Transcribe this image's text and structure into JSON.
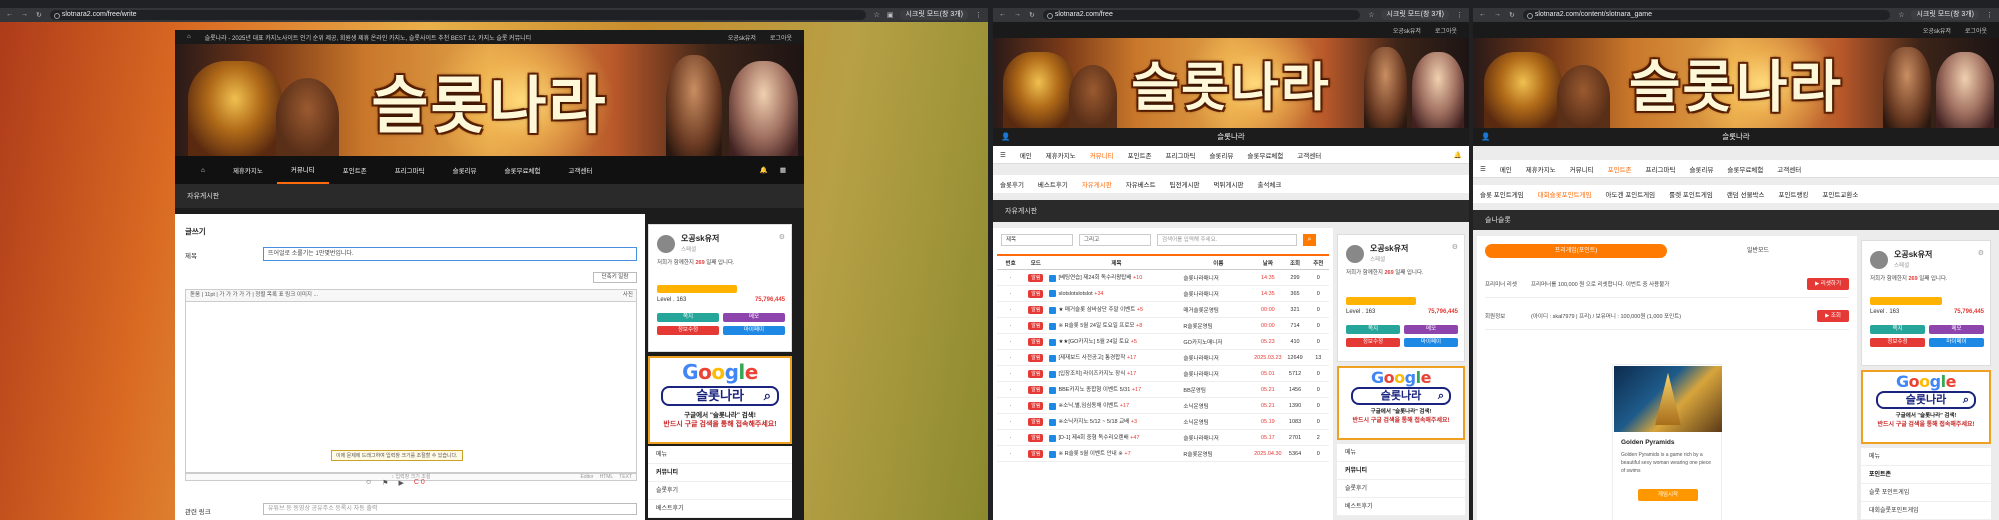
{
  "windows": [
    {
      "url": "slotnara2.com/free/write",
      "ext": "시크릿 모드(창 3개)"
    },
    {
      "url": "slotnara2.com/free",
      "ext": "시크릿 모드(창 3개)"
    },
    {
      "url": "slotnara2.com/content/slotnara_game",
      "ext": "시크릿 모드(창 3개)"
    }
  ],
  "site": {
    "logo": "슬롯나라",
    "brand": "슬롯나라",
    "top_notice": "슬롯나라 - 2025년 대표 카지노사이트 인기 순위 제공, 회원생 제휴 온라인 카지노, 슬롯사이트 추천 BEST 12, 카지노 슬롯 커뮤니티",
    "user_link": "오공sk유저",
    "logout": "로그아웃",
    "nav": [
      "제휴카지노",
      "커뮤니티",
      "포인트존",
      "프리그마틱",
      "슬롯리뷰",
      "슬롯무료체험",
      "고객센터"
    ],
    "nav_mobile": [
      "메인",
      "제휴카지노",
      "커뮤니티",
      "포인트존",
      "프리그마틱",
      "슬롯리뷰",
      "슬롯무료체험",
      "고객센터"
    ]
  },
  "sidebar": {
    "name": "오공sk유저",
    "grade": "스페셜",
    "msg_prefix": "저희가 함께한지",
    "days": "269",
    "msg_suffix": "일째 입니다.",
    "level": "Level . 163",
    "points": "75,796,445",
    "buttons": [
      "쪽지",
      "메모",
      "정보수정",
      "마이페이"
    ],
    "menu_heading": "메뉴",
    "community": "커뮤니티",
    "community_items": [
      "슬롯후기",
      "베스트후기"
    ],
    "pointzone": "포인트존",
    "pointzone_items": [
      "슬롯 포인트게임",
      "대회슬롯포인트게임"
    ]
  },
  "google_ad": {
    "google": [
      "G",
      "o",
      "o",
      "g",
      "l",
      "e"
    ],
    "search_text": "슬롯나라",
    "line1": "구글에서 \"슬롯나라\" 검색!",
    "line2": "반드시 구글 검색을 통해 접속해주세요!"
  },
  "write": {
    "page_title": "자유게시판",
    "form_title": "글쓰기",
    "subject_label": "제목",
    "subject_value": "뜨어얼로 소롤기는 1만몇번입니다.",
    "shortcut_btn": "단축키 일람",
    "toolbar": "돋움   |   11pt   |   가  가  가  가  가  |  정렬  목록  표  링크  이미지  ...",
    "source_label": "사진",
    "tooltip": "이에 문제에 드래그하여 입력창 크기를 조절할 수 있습니다.",
    "bottom_bar": "↕ 입력창 크기 조절",
    "modes": [
      "Editor",
      "HTML",
      "TEXT"
    ],
    "reactions": [
      "☺",
      "⚑",
      "▶",
      "C 0"
    ],
    "link_label": "관련 링크",
    "link_placeholder": "유튜브 등 동영상 공유주소 등록시 자동 출력"
  },
  "board": {
    "page_title": "자유게시판",
    "sub_nav": [
      "슬롯후기",
      "베스트후기",
      "자유게시판",
      "자유베스트",
      "팁전게시판",
      "먹튀게시판",
      "출석체크"
    ],
    "select1": "제목",
    "select2": "그리고",
    "search_placeholder": "검색어를 입력해 주세요.",
    "headers": [
      "번호",
      "모드",
      "제목",
      "이름",
      "날짜",
      "조회",
      "추천"
    ],
    "rows": [
      {
        "no": "·",
        "tag": "알림",
        "title": "[베팅연습] 제24회 독수리왕탑배",
        "plus": "+10",
        "name": "슬롯나라매니저",
        "date": "14:35",
        "views": "299",
        "rec": "0"
      },
      {
        "no": "·",
        "tag": "알림",
        "title": "slotslotslotslot",
        "plus": "+34",
        "name": "슬롯나라매니저",
        "date": "14:35",
        "views": "365",
        "rec": "0"
      },
      {
        "no": "·",
        "tag": "알림",
        "title": "★ 매거슬롯 삼바삼단 주말 이벤트",
        "plus": "+5",
        "name": "매거슬롯운영팀",
        "date": "00:00",
        "views": "321",
        "rec": "0"
      },
      {
        "no": "·",
        "tag": "알림",
        "title": "※ R슬롯 5월 24일 토요일 프로모",
        "plus": "+8",
        "name": "R슬롯운영팀",
        "date": "00:00",
        "views": "714",
        "rec": "0"
      },
      {
        "no": "·",
        "tag": "알림",
        "title": "★★[GO카지노] 5월 24일 토요",
        "plus": "+5",
        "name": "GO카지노매니저",
        "date": "05.23",
        "views": "410",
        "rec": "0"
      },
      {
        "no": "·",
        "tag": "알림",
        "title": "[제재보드 사전공고] 통경합작",
        "plus": "+17",
        "name": "슬롯나라매니저",
        "date": "2025.03.23",
        "views": "12649",
        "rec": "13"
      },
      {
        "no": "·",
        "tag": "알림",
        "title": "[입장조치] 라이즈카지노 장식",
        "plus": "+17",
        "name": "슬롯나라매니저",
        "date": "05.01",
        "views": "5712",
        "rec": "0"
      },
      {
        "no": "·",
        "tag": "알림",
        "title": "BBE카지노 종합형 이벤트 5/31",
        "plus": "+17",
        "name": "BB운영팀",
        "date": "05.21",
        "views": "1456",
        "rec": "0"
      },
      {
        "no": "·",
        "tag": "알림",
        "title": "※소닉,별,임심동채 이벤트",
        "plus": "+17",
        "name": "소닉운영팀",
        "date": "05.21",
        "views": "1390",
        "rec": "0"
      },
      {
        "no": "·",
        "tag": "알림",
        "title": "※소닉카지노 5/12 ~ 5/18 교배",
        "plus": "+3",
        "name": "소닉운영팀",
        "date": "05.19",
        "views": "1083",
        "rec": "0"
      },
      {
        "no": "·",
        "tag": "알림",
        "title": "[D-1] 제4회 중형 독수리오렌배",
        "plus": "+47",
        "name": "슬롯나라매니저",
        "date": "05.17",
        "views": "2701",
        "rec": "2"
      },
      {
        "no": "·",
        "tag": "알림",
        "title": "※ R슬롯 5월 이벤트 안내 ※",
        "plus": "+7",
        "name": "R슬롯운영팀",
        "date": "2025.04.30",
        "views": "5364",
        "rec": "0"
      }
    ]
  },
  "game": {
    "page_title": "슬나슬롯",
    "sub_nav": [
      "슬롯 포인트게임",
      "대회슬롯포인트게임",
      "아도겐 포인트게임",
      "룰렛 포인트게임",
      "랜덤 선물박스",
      "포인트랭킹",
      "포인트교환소"
    ],
    "tabs": [
      "프리게임(포인트)",
      "일반모드"
    ],
    "row1_label": "프리미너 리셋",
    "row1_text": "프리머너를 100,000 원 으로 리셋합니다. 이번트 중 사용불가",
    "row1_btn": "▶ 리셋하기",
    "row2_label": "회원정보",
    "row2_text": "(아이디 : skal7979 | 프리) / 보유머니 : 100,000원 (1,000 포인트)",
    "row2_btn": "▶ 조회",
    "game_title": "Golden Pyramids",
    "game_desc": "Golden Pyramids is a game rich by a beautiful sexy woman wearing one piece of swims",
    "game_btn": "게임시작"
  }
}
